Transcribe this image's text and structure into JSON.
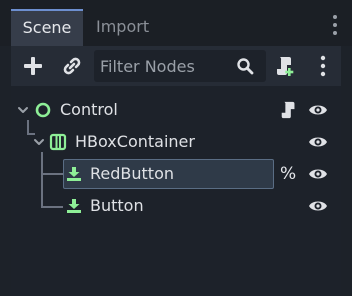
{
  "tabs": [
    {
      "label": "Scene",
      "active": true
    },
    {
      "label": "Import",
      "active": false
    }
  ],
  "toolbar": {
    "filter_placeholder": "Filter Nodes",
    "filter_value": ""
  },
  "tree": [
    {
      "label": "Control",
      "icon": "control-node-icon",
      "depth": 0,
      "expanded": true,
      "has_script": true,
      "visible": true
    },
    {
      "label": "HBoxContainer",
      "icon": "hboxcontainer-node-icon",
      "depth": 1,
      "expanded": true,
      "visible": true
    },
    {
      "label": "RedButton",
      "icon": "button-node-icon",
      "depth": 2,
      "selected": true,
      "unique_name": true,
      "badge": "%",
      "visible": true
    },
    {
      "label": "Button",
      "icon": "button-node-icon",
      "depth": 2,
      "visible": true
    }
  ],
  "colors": {
    "background": "#1d2229",
    "panel": "#262c36",
    "tree_background": "#1d222a",
    "active_tab": "#363d4a",
    "active_tab_accent": "#6d8fd0",
    "control_node": "#8eef97",
    "selection": "#2f3a48",
    "text": "#dfe1e5",
    "muted_text": "#8b9098"
  }
}
